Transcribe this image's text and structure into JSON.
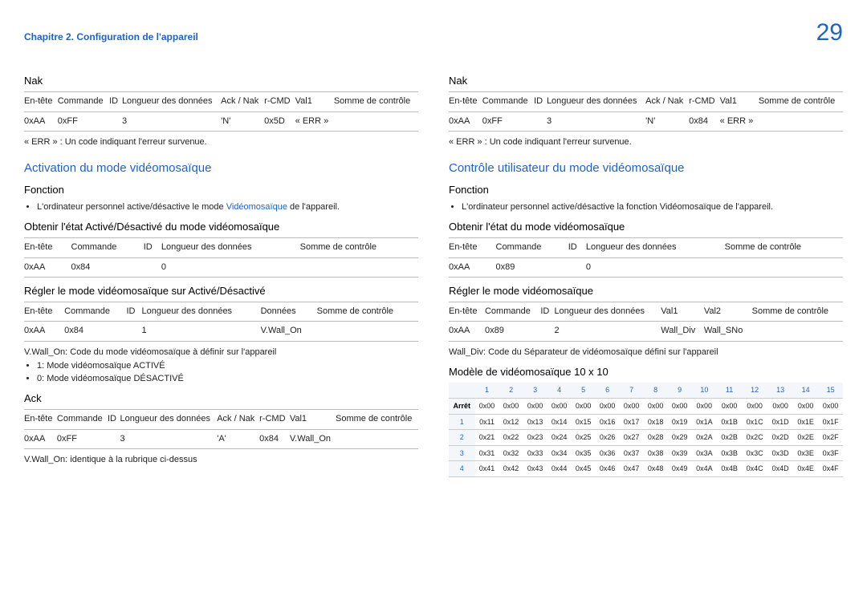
{
  "header": {
    "chapter": "Chapitre 2. Configuration de l'appareil",
    "page": "29"
  },
  "left": {
    "nak_title": "Nak",
    "nak_table": {
      "heads": [
        "En-tête",
        "Commande",
        "ID",
        "Longueur des données",
        "Ack / Nak",
        "r-CMD",
        "Val1",
        "Somme de contrôle"
      ],
      "row": [
        "0xAA",
        "0xFF",
        "",
        "3",
        "'N'",
        "0x5D",
        "« ERR »",
        ""
      ]
    },
    "err_note": "« ERR » : Un code indiquant l'erreur survenue.",
    "section1": "Activation du mode vidéomosaïque",
    "fn_title": "Fonction",
    "fn_bullet_pre": "L'ordinateur personnel active/désactive le mode ",
    "fn_bullet_blue": "Vidéomosaïque",
    "fn_bullet_post": " de l'appareil.",
    "obtain_title": "Obtenir l'état Activé/Désactivé du mode vidéomosaïque",
    "obtain_table": {
      "heads": [
        "En-tête",
        "Commande",
        "ID",
        "Longueur des données",
        "Somme de contrôle"
      ],
      "row": [
        "0xAA",
        "0x84",
        "",
        "0",
        ""
      ]
    },
    "set_title": "Régler le mode vidéomosaïque sur Activé/Désactivé",
    "set_table": {
      "heads": [
        "En-tête",
        "Commande",
        "ID",
        "Longueur des données",
        "Données",
        "Somme de contrôle"
      ],
      "row": [
        "0xAA",
        "0x84",
        "",
        "1",
        "V.Wall_On",
        ""
      ]
    },
    "vwall_note": "V.Wall_On: Code du mode vidéomosaïque à définir sur l'appareil",
    "vwall_b1": "1: Mode vidéomosaïque ACTIVÉ",
    "vwall_b2": "0: Mode vidéomosaïque DÉSACTIVÉ",
    "ack_title": "Ack",
    "ack_table": {
      "heads": [
        "En-tête",
        "Commande",
        "ID",
        "Longueur des données",
        "Ack / Nak",
        "r-CMD",
        "Val1",
        "Somme de contrôle"
      ],
      "row": [
        "0xAA",
        "0xFF",
        "",
        "3",
        "'A'",
        "0x84",
        "V.Wall_On",
        ""
      ]
    },
    "ack_note": "V.Wall_On: identique à la rubrique ci-dessus"
  },
  "right": {
    "nak_title": "Nak",
    "nak_table": {
      "heads": [
        "En-tête",
        "Commande",
        "ID",
        "Longueur des données",
        "Ack / Nak",
        "r-CMD",
        "Val1",
        "Somme de contrôle"
      ],
      "row": [
        "0xAA",
        "0xFF",
        "",
        "3",
        "'N'",
        "0x84",
        "« ERR »",
        ""
      ]
    },
    "err_note": "« ERR » : Un code indiquant l'erreur survenue.",
    "section1": "Contrôle utilisateur du mode vidéomosaïque",
    "fn_title": "Fonction",
    "fn_bullet": "L'ordinateur personnel active/désactive la fonction Vidéomosaïque de l'appareil.",
    "obtain_title": "Obtenir l'état du mode vidéomosaïque",
    "obtain_table": {
      "heads": [
        "En-tête",
        "Commande",
        "ID",
        "Longueur des données",
        "Somme de contrôle"
      ],
      "row": [
        "0xAA",
        "0x89",
        "",
        "0",
        ""
      ]
    },
    "set_title": "Régler le mode vidéomosaïque",
    "set_table": {
      "heads": [
        "En-tête",
        "Commande",
        "ID",
        "Longueur des données",
        "Val1",
        "Val2",
        "Somme de contrôle"
      ],
      "row": [
        "0xAA",
        "0x89",
        "",
        "2",
        "Wall_Div",
        "Wall_SNo",
        ""
      ]
    },
    "walldiv_note": "Wall_Div: Code du Séparateur de vidéomosaïque défini sur l'appareil",
    "matrix_title": "Modèle de vidéomosaïque 10 x 10",
    "matrix": {
      "cols": [
        "1",
        "2",
        "3",
        "4",
        "5",
        "6",
        "7",
        "8",
        "9",
        "10",
        "11",
        "12",
        "13",
        "14",
        "15"
      ],
      "off_label": "Arrêt",
      "off_row": [
        "0x00",
        "0x00",
        "0x00",
        "0x00",
        "0x00",
        "0x00",
        "0x00",
        "0x00",
        "0x00",
        "0x00",
        "0x00",
        "0x00",
        "0x00",
        "0x00",
        "0x00"
      ],
      "rows": [
        {
          "h": "1",
          "v": [
            "0x11",
            "0x12",
            "0x13",
            "0x14",
            "0x15",
            "0x16",
            "0x17",
            "0x18",
            "0x19",
            "0x1A",
            "0x1B",
            "0x1C",
            "0x1D",
            "0x1E",
            "0x1F"
          ]
        },
        {
          "h": "2",
          "v": [
            "0x21",
            "0x22",
            "0x23",
            "0x24",
            "0x25",
            "0x26",
            "0x27",
            "0x28",
            "0x29",
            "0x2A",
            "0x2B",
            "0x2C",
            "0x2D",
            "0x2E",
            "0x2F"
          ]
        },
        {
          "h": "3",
          "v": [
            "0x31",
            "0x32",
            "0x33",
            "0x34",
            "0x35",
            "0x36",
            "0x37",
            "0x38",
            "0x39",
            "0x3A",
            "0x3B",
            "0x3C",
            "0x3D",
            "0x3E",
            "0x3F"
          ]
        },
        {
          "h": "4",
          "v": [
            "0x41",
            "0x42",
            "0x43",
            "0x44",
            "0x45",
            "0x46",
            "0x47",
            "0x48",
            "0x49",
            "0x4A",
            "0x4B",
            "0x4C",
            "0x4D",
            "0x4E",
            "0x4F"
          ]
        }
      ]
    }
  }
}
